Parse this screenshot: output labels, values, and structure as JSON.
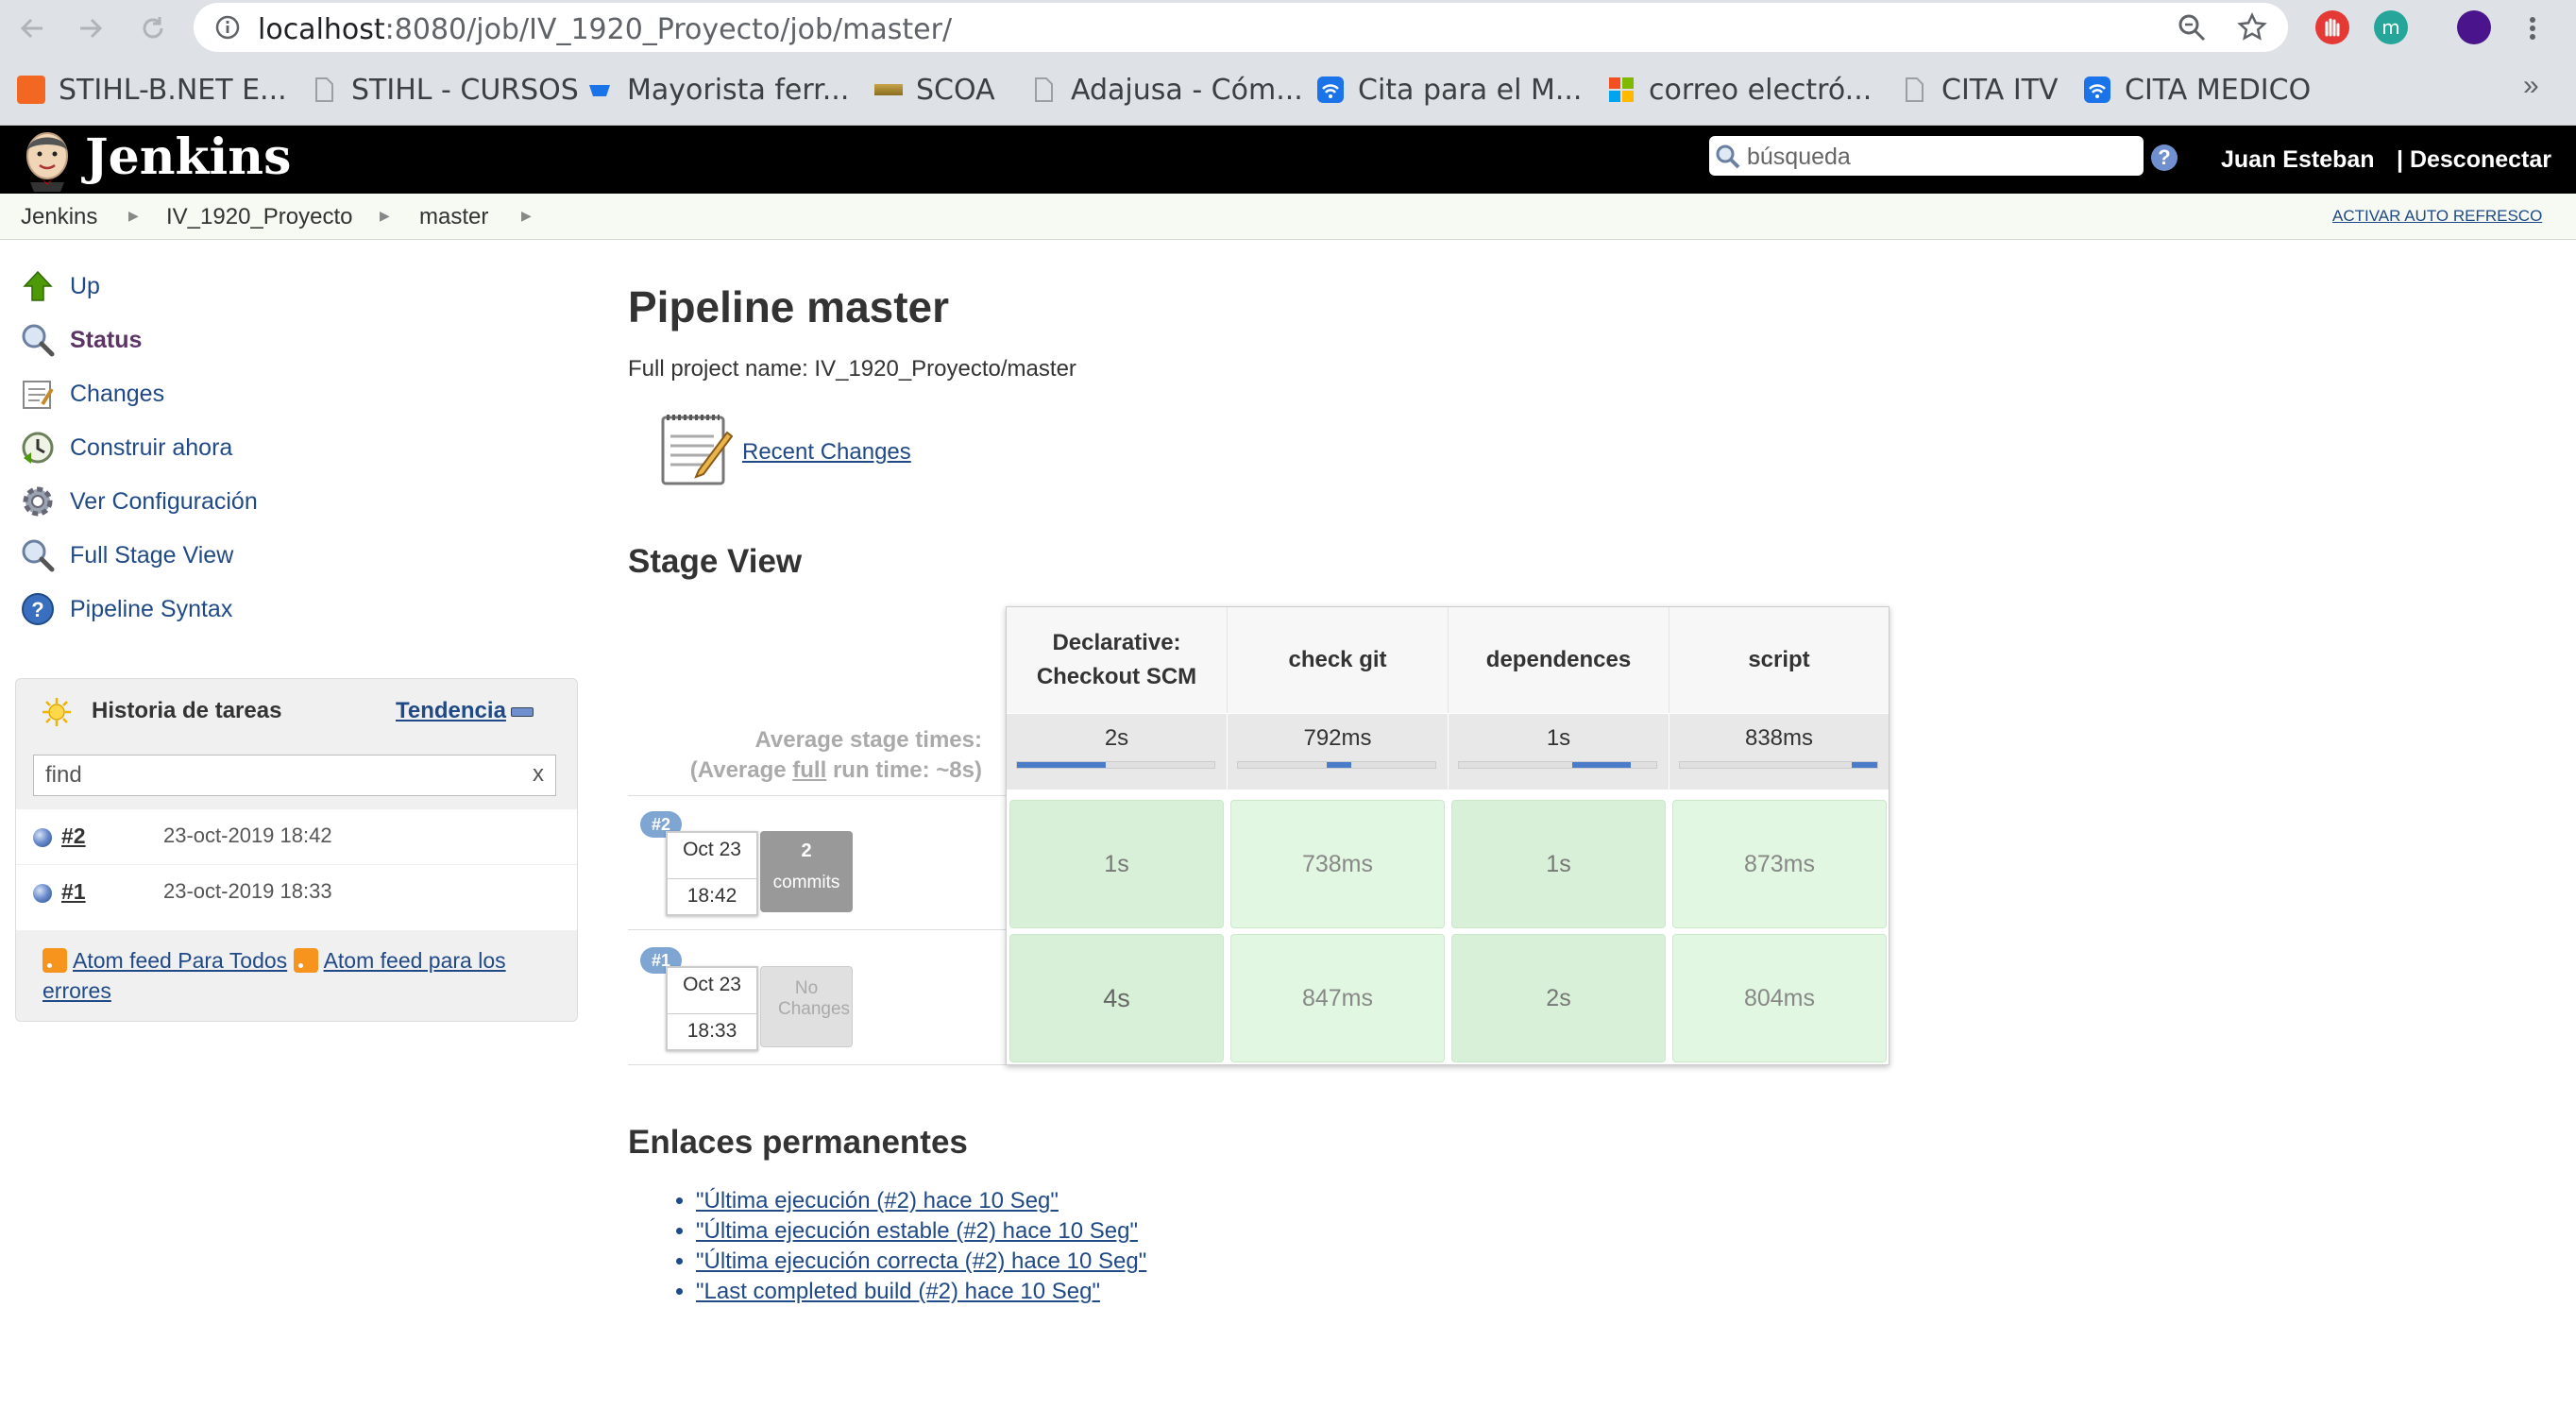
{
  "browser": {
    "url_host": "localhost",
    "url_path": ":8080/job/IV_1920_Proyecto/job/master/",
    "bookmarks": [
      {
        "label": "STIHL-B.NET E...",
        "icon": "stihl-icon",
        "color": "#f26722"
      },
      {
        "label": "STIHL - CURSOS",
        "icon": "page-icon",
        "color": "#9aa0a6"
      },
      {
        "label": "Mayorista ferr...",
        "icon": "store-icon",
        "color": "#1a73e8"
      },
      {
        "label": "SCOA",
        "icon": "scoa-icon",
        "color": "#8a6d1f"
      },
      {
        "label": "Adajusa - Cóm...",
        "icon": "page-icon",
        "color": "#9aa0a6"
      },
      {
        "label": "Cita para el M...",
        "icon": "wifi-icon",
        "color": "#1a73e8"
      },
      {
        "label": "correo electró...",
        "icon": "windows-icon",
        "color": "#f25022"
      },
      {
        "label": "CITA ITV",
        "icon": "page-icon",
        "color": "#9aa0a6"
      },
      {
        "label": "CITA MEDICO",
        "icon": "wifi-icon",
        "color": "#1a73e8"
      }
    ],
    "more": "»"
  },
  "header": {
    "logo_text": "Jenkins",
    "search_placeholder": "búsqueda",
    "help": "?",
    "user": "Juan Esteban",
    "logout": "| Desconectar"
  },
  "breadcrumb": {
    "items": [
      "Jenkins",
      "IV_1920_Proyecto",
      "master"
    ],
    "autorefresh": "ACTIVAR AUTO REFRESCO"
  },
  "sidebar": {
    "tasks": [
      {
        "label": "Up",
        "icon": "up-arrow-icon"
      },
      {
        "label": "Status",
        "icon": "magnifier-icon"
      },
      {
        "label": "Changes",
        "icon": "notepad-icon"
      },
      {
        "label": "Construir ahora",
        "icon": "clock-icon"
      },
      {
        "label": "Ver Configuración",
        "icon": "gear-icon"
      },
      {
        "label": "Full Stage View",
        "icon": "magnifier-icon"
      },
      {
        "label": "Pipeline Syntax",
        "icon": "help-icon"
      }
    ],
    "history": {
      "title": "Historia de tareas",
      "trend": "Tendencia",
      "find_placeholder": "find",
      "clear": "x",
      "builds": [
        {
          "num": "#2",
          "date": "23-oct-2019 18:42"
        },
        {
          "num": "#1",
          "date": "23-oct-2019 18:33"
        }
      ],
      "feed_all": "Atom feed Para Todos",
      "feed_errors": "Atom feed para los errores"
    }
  },
  "main": {
    "title": "Pipeline master",
    "full_name": "Full project name: IV_1920_Proyecto/master",
    "recent_changes": "Recent Changes",
    "stage_view_title": "Stage View",
    "avg_label_1": "Average stage times:",
    "avg_label_2a": "(Average ",
    "avg_label_2b": "full",
    "avg_label_2c": " run time: ~8s)",
    "stages": [
      {
        "name_1": "Declarative:",
        "name_2": "Checkout SCM",
        "avg": "2s"
      },
      {
        "name_1": "check git",
        "name_2": "",
        "avg": "792ms"
      },
      {
        "name_1": "dependences",
        "name_2": "",
        "avg": "1s"
      },
      {
        "name_1": "script",
        "name_2": "",
        "avg": "838ms"
      }
    ],
    "runs": [
      {
        "badge": "#2",
        "date": "Oct 23",
        "time": "18:42",
        "changes_count": "2",
        "changes_label": "commits",
        "cells": [
          "1s",
          "738ms",
          "1s",
          "873ms"
        ]
      },
      {
        "badge": "#1",
        "date": "Oct 23",
        "time": "18:33",
        "changes_count": "",
        "changes_label": "No Changes",
        "cells": [
          "4s",
          "847ms",
          "2s",
          "804ms"
        ]
      }
    ],
    "permalinks_title": "Enlaces permanentes",
    "permalinks": [
      "\"Última ejecución (#2) hace 10 Seg\"",
      "\"Última ejecución estable (#2) hace 10 Seg\"",
      "\"Última ejecución correcta (#2) hace 10 Seg\"",
      "\"Last completed build (#2) hace 10 Seg\""
    ]
  }
}
